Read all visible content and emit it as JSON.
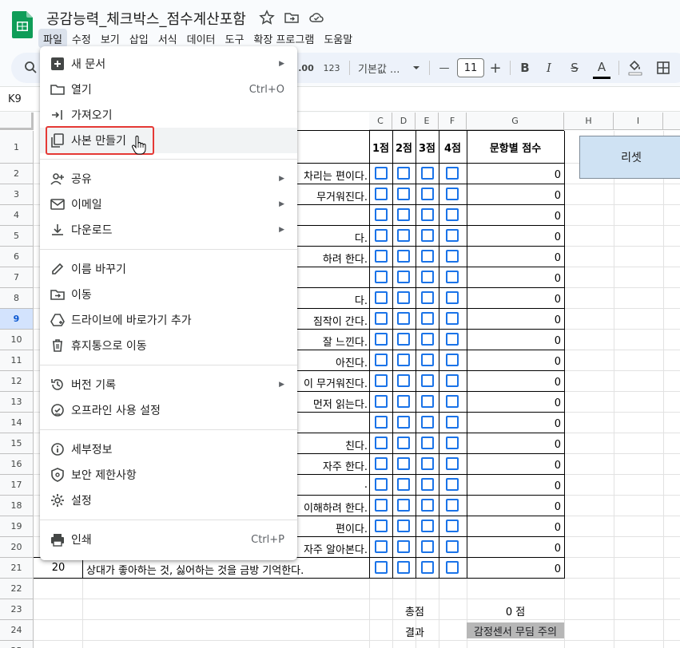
{
  "doc": {
    "title": "공감능력_체크박스_점수계산포함"
  },
  "menubar": [
    "파일",
    "수정",
    "보기",
    "삽입",
    "서식",
    "데이터",
    "도구",
    "확장 프로그램",
    "도움말"
  ],
  "toolbar": {
    "format_123": "123",
    "decimal_label": ".00",
    "font_name": "기본값 ...",
    "font_size": "11",
    "minus": "—",
    "plus": "+",
    "bold": "B",
    "italic": "I",
    "strike": "S",
    "textcolor": "A"
  },
  "formula_bar": {
    "cell_ref": "K9"
  },
  "grid": {
    "columns": [
      "C",
      "D",
      "E",
      "F",
      "G",
      "H",
      "I"
    ],
    "row_numbers": [
      "1",
      "2",
      "3",
      "4",
      "5",
      "6",
      "7",
      "8",
      "9",
      "10",
      "11",
      "12",
      "13",
      "14",
      "15",
      "16",
      "17",
      "18",
      "19",
      "20",
      "21",
      "22",
      "23",
      "24",
      "25"
    ],
    "header_row": [
      "1점",
      "2점",
      "3점",
      "4점",
      "문항별 점수"
    ],
    "reset_label": "리셋",
    "visible_text": [
      "차리는 편이다.",
      "무거워진다.",
      "",
      "다.",
      "하려 한다.",
      "",
      "다.",
      "짐작이 간다.",
      "잘 느낀다.",
      "아진다.",
      "이 무거워진다.",
      "먼저 읽는다.",
      "",
      "친다.",
      "자주 한다.",
      ".",
      "이해하려 한다.",
      "편이다.",
      "자주 알아본다."
    ],
    "row21": {
      "num": "20",
      "text": "상대가 좋아하는 것, 싫어하는 것을 금방 기억한다."
    },
    "scores": [
      "0",
      "0",
      "0",
      "0",
      "0",
      "0",
      "0",
      "0",
      "0",
      "0",
      "0",
      "0",
      "0",
      "0",
      "0",
      "0",
      "0",
      "0",
      "0",
      "0"
    ],
    "total_label": "총점",
    "total_value": "0 점",
    "result_label": "결과",
    "result_value": "감정센서 무딤 주의"
  },
  "file_menu": {
    "items": [
      {
        "label": "새 문서",
        "icon": "new-document-icon",
        "submenu": true
      },
      {
        "label": "열기",
        "icon": "folder-icon",
        "shortcut": "Ctrl+O"
      },
      {
        "label": "가져오기",
        "icon": "import-icon"
      },
      {
        "label": "사본 만들기",
        "icon": "copy-icon"
      },
      {
        "label": "공유",
        "icon": "share-icon",
        "submenu": true
      },
      {
        "label": "이메일",
        "icon": "email-icon",
        "submenu": true
      },
      {
        "label": "다운로드",
        "icon": "download-icon",
        "submenu": true
      },
      {
        "label": "이름 바꾸기",
        "icon": "pencil-icon"
      },
      {
        "label": "이동",
        "icon": "move-folder-icon"
      },
      {
        "label": "드라이브에 바로가기 추가",
        "icon": "drive-shortcut-icon"
      },
      {
        "label": "휴지통으로 이동",
        "icon": "trash-icon"
      },
      {
        "label": "버전 기록",
        "icon": "history-icon",
        "submenu": true
      },
      {
        "label": "오프라인 사용 설정",
        "icon": "offline-icon"
      },
      {
        "label": "세부정보",
        "icon": "info-icon"
      },
      {
        "label": "보안 제한사항",
        "icon": "security-icon"
      },
      {
        "label": "설정",
        "icon": "gear-icon"
      },
      {
        "label": "인쇄",
        "icon": "print-icon",
        "shortcut": "Ctrl+P"
      }
    ]
  },
  "colors": {
    "accent": "#1a73e8",
    "highlight": "#e53935",
    "reset_bg": "#cfe2f3",
    "result_bg": "#b7b7b7"
  }
}
